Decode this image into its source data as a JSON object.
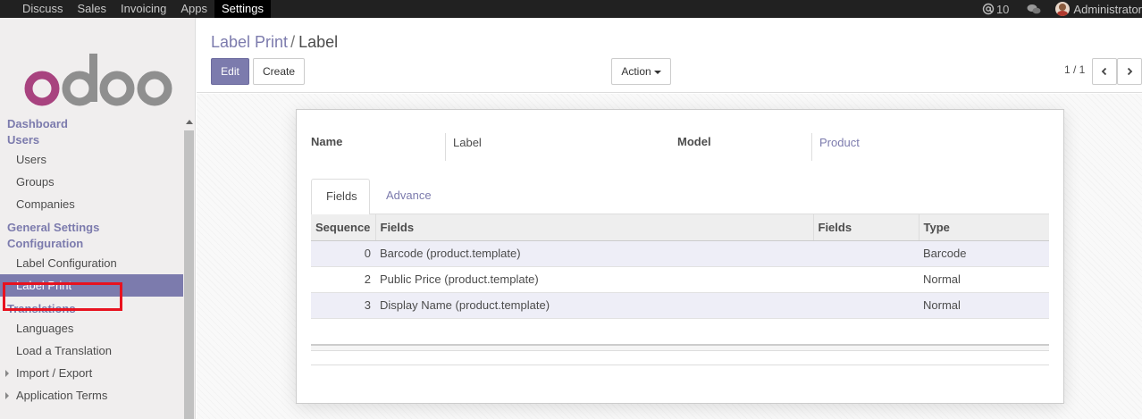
{
  "topbar": {
    "menu": [
      "Discuss",
      "Sales",
      "Invoicing",
      "Apps",
      "Settings"
    ],
    "active_index": 4,
    "message_count": "10",
    "user": "Administrator",
    "icons": [
      "at-icon",
      "chat-icon"
    ]
  },
  "sidebar": {
    "logo_text": "odoo",
    "sections": [
      {
        "title": "Dashboard",
        "items": []
      },
      {
        "title": "Users",
        "items": [
          "Users",
          "Groups",
          "Companies"
        ]
      },
      {
        "title": "General Settings",
        "items": []
      },
      {
        "title": "Configuration",
        "items": [
          "Label Configuration",
          "Label Print"
        ]
      },
      {
        "title": "Translations",
        "items": [
          "Languages",
          "Load a Translation",
          "Import / Export",
          "Application Terms"
        ]
      }
    ],
    "active_item": "Label Print",
    "colors": {
      "accent": "#7c7bad",
      "highlight_border": "#e8121f"
    }
  },
  "control": {
    "breadcrumb_parent": "Label Print",
    "breadcrumb_separator": "/",
    "breadcrumb_current": "Label",
    "edit_label": "Edit",
    "create_label": "Create",
    "action_label": "Action",
    "pager_text": "1 / 1"
  },
  "form": {
    "name_label": "Name",
    "name_value": "Label",
    "model_label": "Model",
    "model_value": "Product",
    "tabs": [
      "Fields",
      "Advance"
    ],
    "active_tab": 0,
    "table": {
      "headers": [
        "Sequence",
        "Fields",
        "Fields",
        "Type"
      ],
      "rows": [
        {
          "sequence": "0",
          "field": "Barcode (product.template)",
          "fields2": "",
          "type": "Barcode"
        },
        {
          "sequence": "2",
          "field": "Public Price (product.template)",
          "fields2": "",
          "type": "Normal"
        },
        {
          "sequence": "3",
          "field": "Display Name (product.template)",
          "fields2": "",
          "type": "Normal"
        }
      ]
    }
  }
}
